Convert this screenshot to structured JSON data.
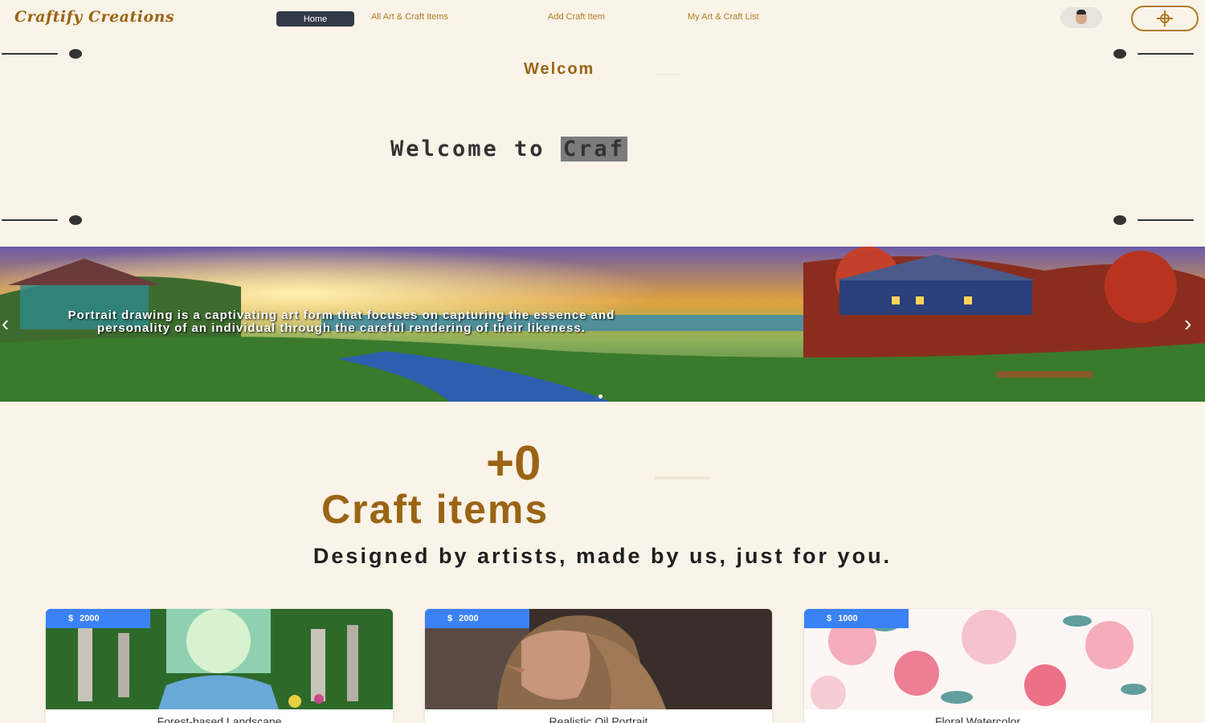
{
  "brand": {
    "name": "Craftify Creations"
  },
  "nav": {
    "home": "Home",
    "links": [
      "All Art & Craft Items",
      "Add Craft Item",
      "My Art & Craft List"
    ]
  },
  "hero": {
    "welcome_small": "Welcom",
    "welcome_big_prefix": "Welcome to ",
    "welcome_big_highlight": "Craf"
  },
  "carousel": {
    "caption": "Portrait drawing is a captivating art form that focuses on capturing the essence and personality of an individual through the careful rendering of their likeness.",
    "prev": "‹",
    "next": "›"
  },
  "stats": {
    "count": "+0",
    "label": "Craft items",
    "tagline": "Designed by artists, made by us, just for you."
  },
  "cards": [
    {
      "currency": "$",
      "price": "2000",
      "title": "Forest-based Landscape"
    },
    {
      "currency": "$",
      "price": "2000",
      "title": "Realistic Oil Portrait"
    },
    {
      "currency": "$",
      "price": "1000",
      "title": "Floral Watercolor"
    }
  ],
  "colors": {
    "background": "#faf3e8",
    "accent": "#9a6414",
    "badge": "#3b82f6",
    "home_button": "#333a47"
  }
}
